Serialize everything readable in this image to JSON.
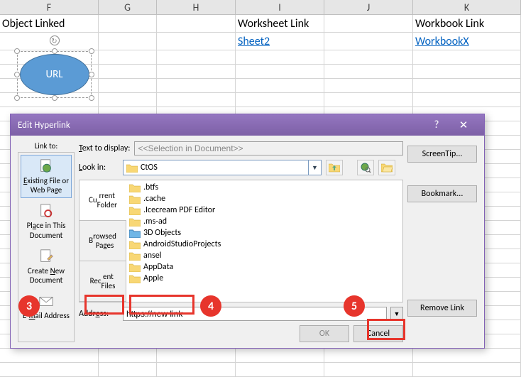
{
  "columns": [
    "F",
    "G",
    "H",
    "I",
    "J",
    "K"
  ],
  "headers": {
    "F": "Object Linked",
    "I": "Worksheet Link",
    "K": "Workbook Link"
  },
  "links": {
    "I": "Sheet2",
    "K": "WorkbookX"
  },
  "shape_text": "URL",
  "dialog": {
    "title": "Edit Hyperlink",
    "link_to_label": "Link to:",
    "options": {
      "existing": "Existing File or Web Page",
      "place": "Place in This Document",
      "createnew": "Create New Document",
      "email": "E-mail Address"
    },
    "text_to_display_label": "Text to display:",
    "text_to_display_value": "<<Selection in Document>>",
    "screentip": "ScreenTip...",
    "look_in_label": "Look in:",
    "look_in_value": "CtOS",
    "tabs": {
      "current": "Current Folder",
      "browsed": "Browsed Pages",
      "recent": "Recent Files"
    },
    "files": [
      ".btfs",
      ".cache",
      ".Icecream PDF Editor",
      ".ms-ad",
      "3D Objects",
      "AndroidStudioProjects",
      "ansel",
      "AppData",
      "Apple"
    ],
    "address_label": "Address:",
    "address_value": "https://new link",
    "bookmark": "Bookmark...",
    "remove": "Remove Link",
    "ok": "OK",
    "cancel": "Cancel"
  },
  "callouts": {
    "c3": "3",
    "c4": "4",
    "c5": "5"
  }
}
